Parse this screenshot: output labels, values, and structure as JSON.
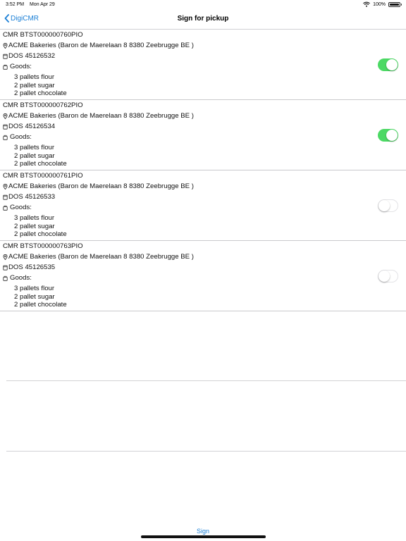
{
  "status_bar": {
    "time": "3:52 PM",
    "date": "Mon Apr 29",
    "battery": "100%"
  },
  "nav": {
    "back_label": "DigiCMR",
    "title": "Sign for pickup"
  },
  "items": [
    {
      "cmr": "CMR  BTST000000760PIO",
      "address": "ACME Bakeries (Baron de Maerelaan 8 8380 Zeebrugge BE )",
      "dos": "DOS  45126532",
      "goods_label": "Goods:",
      "goods": [
        "3 pallets flour",
        "2 pallet sugar",
        "2 pallet chocolate"
      ],
      "selected": true
    },
    {
      "cmr": "CMR  BTST000000762PIO",
      "address": "ACME Bakeries (Baron de Maerelaan 8 8380 Zeebrugge BE )",
      "dos": "DOS  45126534",
      "goods_label": "Goods:",
      "goods": [
        "3 pallets flour",
        "2 pallet sugar",
        "2 pallet chocolate"
      ],
      "selected": true
    },
    {
      "cmr": "CMR  BTST000000761PIO",
      "address": "ACME Bakeries (Baron de Maerelaan 8 8380 Zeebrugge BE )",
      "dos": "DOS  45126533",
      "goods_label": "Goods:",
      "goods": [
        "3 pallets flour",
        "2 pallet sugar",
        "2 pallet chocolate"
      ],
      "selected": false
    },
    {
      "cmr": "CMR  BTST000000763PIO",
      "address": "ACME Bakeries (Baron de Maerelaan 8 8380 Zeebrugge BE )",
      "dos": "DOS  45126535",
      "goods_label": "Goods:",
      "goods": [
        "3 pallets flour",
        "2 pallet sugar",
        "2 pallet chocolate"
      ],
      "selected": false
    }
  ],
  "footer": {
    "sign_label": "Sign"
  },
  "colors": {
    "accent": "#1a7fd6",
    "toggle_on": "#4cd964",
    "separator": "#c9c9cc"
  },
  "icons": {
    "location": "location-pin-icon",
    "document": "document-icon",
    "goods": "package-icon",
    "back": "chevron-left-icon",
    "wifi": "wifi-icon",
    "battery": "battery-icon"
  }
}
